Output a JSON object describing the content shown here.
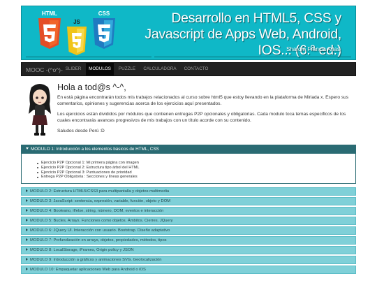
{
  "banner": {
    "title": "Desarrollo en HTML5, CSS y Javascript de Apps Web, Android, IOS... (6.ª ed.)",
    "author": "Sharom Francia Arias",
    "logos": [
      "HTML",
      "JS",
      "CSS"
    ],
    "colors": {
      "background": "#0fb8c7",
      "html": "#e44d26",
      "js": "#f0c419",
      "css": "#1f7bc1"
    }
  },
  "nav": {
    "brand": "MOOC -(^o^)-",
    "items": [
      {
        "label": "SLIDER",
        "active": false
      },
      {
        "label": "MODULOS",
        "active": true
      },
      {
        "label": "PUZZLE",
        "active": false
      },
      {
        "label": "CALCULADORA",
        "active": false
      },
      {
        "label": "CONTACTO",
        "active": false
      }
    ]
  },
  "intro": {
    "greeting": "Hola a tod@s ^-^,",
    "p1": "En está página encontrarán todos mis trabajos relacionados al curso sobre html5 que estoy llevando en la plataforma de Miriada x. Espero sus comentarios, opiniones y sugerencias acerca de los ejercicios aquí presentados.",
    "p2": "Los ejercicios están divididos por módulos que contienen entregas P2P opcionales y obligatorias. Cada modulo toca temas especificos de los cuales encontrarás avances progresivos de mis trabajos con un título acorde con su contenido.",
    "p3": "Saludos desde Perú :D"
  },
  "modules": {
    "open": {
      "title": "MODULO 1: Introducción a los elementos básicos de HTML, CSS",
      "items": [
        "Ejercicio P2P Opcional 1: Mi primera página con imagen",
        "Ejercicio P2P Opcional 2: Estructura tipo árbol del HTML",
        "Ejercicio P2P Opcional 3: Puntuaciones de prioridad",
        "Entrega P2P Obligatoria : Secciones y líneas generales"
      ]
    },
    "closed": [
      "MODULO 2: Estructura HTML5/CSS3 para multipantalla y objetos multimedia",
      "MODULO 3: JavaScript: sentencia, expresión, variable, función, objeto y DOM",
      "MODULO 4: Booleano, if/else, string, número, DOM, eventos e interacción",
      "MODULO 5: Bucles, Arrays. Funciones como objetos. Ámbitos. Cierres. JQuery",
      "MODULO 6: JQuery UI. Interacción con usuario. Bootstrap. Diseño adaptativo",
      "MODULO 7: Profundización en arrays, objetos, propiedades, métodos, tipos",
      "MODULO 8: LocalStorage, iFrames, Origin policy y JSON",
      "MODULO 9: Introducción a gráficos y animaciones SVG. Geolocalización",
      "MODULO 10: Empaquetar aplicaciones Web para Android o iOS"
    ]
  }
}
